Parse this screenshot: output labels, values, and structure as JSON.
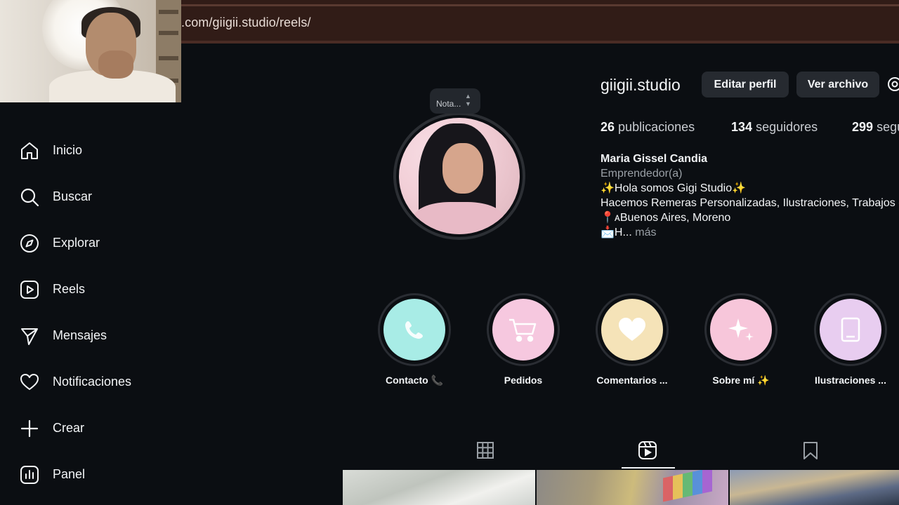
{
  "browser": {
    "url": ".com/giigii.studio/reels/"
  },
  "sidebar": {
    "items": [
      {
        "label": "Inicio",
        "icon": "home-icon"
      },
      {
        "label": "Buscar",
        "icon": "search-icon"
      },
      {
        "label": "Explorar",
        "icon": "compass-icon"
      },
      {
        "label": "Reels",
        "icon": "reels-icon"
      },
      {
        "label": "Mensajes",
        "icon": "send-icon"
      },
      {
        "label": "Notificaciones",
        "icon": "heart-icon"
      },
      {
        "label": "Crear",
        "icon": "plus-icon"
      },
      {
        "label": "Panel",
        "icon": "chart-icon"
      }
    ]
  },
  "profile": {
    "note": "Nota...",
    "username": "giigii.studio",
    "edit_button": "Editar perfil",
    "archive_button": "Ver archivo",
    "stats": {
      "posts_count": "26",
      "posts_label": "publicaciones",
      "followers_count": "134",
      "followers_label": "seguidores",
      "following_count": "299",
      "following_label": "seguidos"
    },
    "bio": {
      "name": "Maria Gissel Candia",
      "category": "Emprendedor(a)",
      "line1": "✨Hola somos Gigi Studio✨",
      "line2": "Hacemos Remeras Personalizadas, Ilustraciones, Trabajos de",
      "line3": "📍ᴀBuenos Aires, Moreno",
      "line4": "📩H...",
      "more": "más"
    }
  },
  "highlights": [
    {
      "label": "Contacto 📞",
      "color": "#a8ece6",
      "icon": "phone-icon"
    },
    {
      "label": "Pedidos",
      "color": "#f6c8df",
      "icon": "cart-icon"
    },
    {
      "label": "Comentarios ...",
      "color": "#f5e3b8",
      "icon": "heart-icon"
    },
    {
      "label": "Sobre mí ✨",
      "color": "#f7c6da",
      "icon": "sparkles-icon"
    },
    {
      "label": "Ilustraciones ...",
      "color": "#e8cdf0",
      "icon": "tablet-icon"
    }
  ],
  "tabs": [
    {
      "name": "posts",
      "icon": "grid-icon",
      "active": false
    },
    {
      "name": "reels",
      "icon": "reels-icon",
      "active": true
    },
    {
      "name": "saved",
      "icon": "bookmark-icon",
      "active": false
    }
  ],
  "colors": {
    "background": "#0b0e12",
    "button": "#262a30",
    "chrome": "#311c17"
  }
}
